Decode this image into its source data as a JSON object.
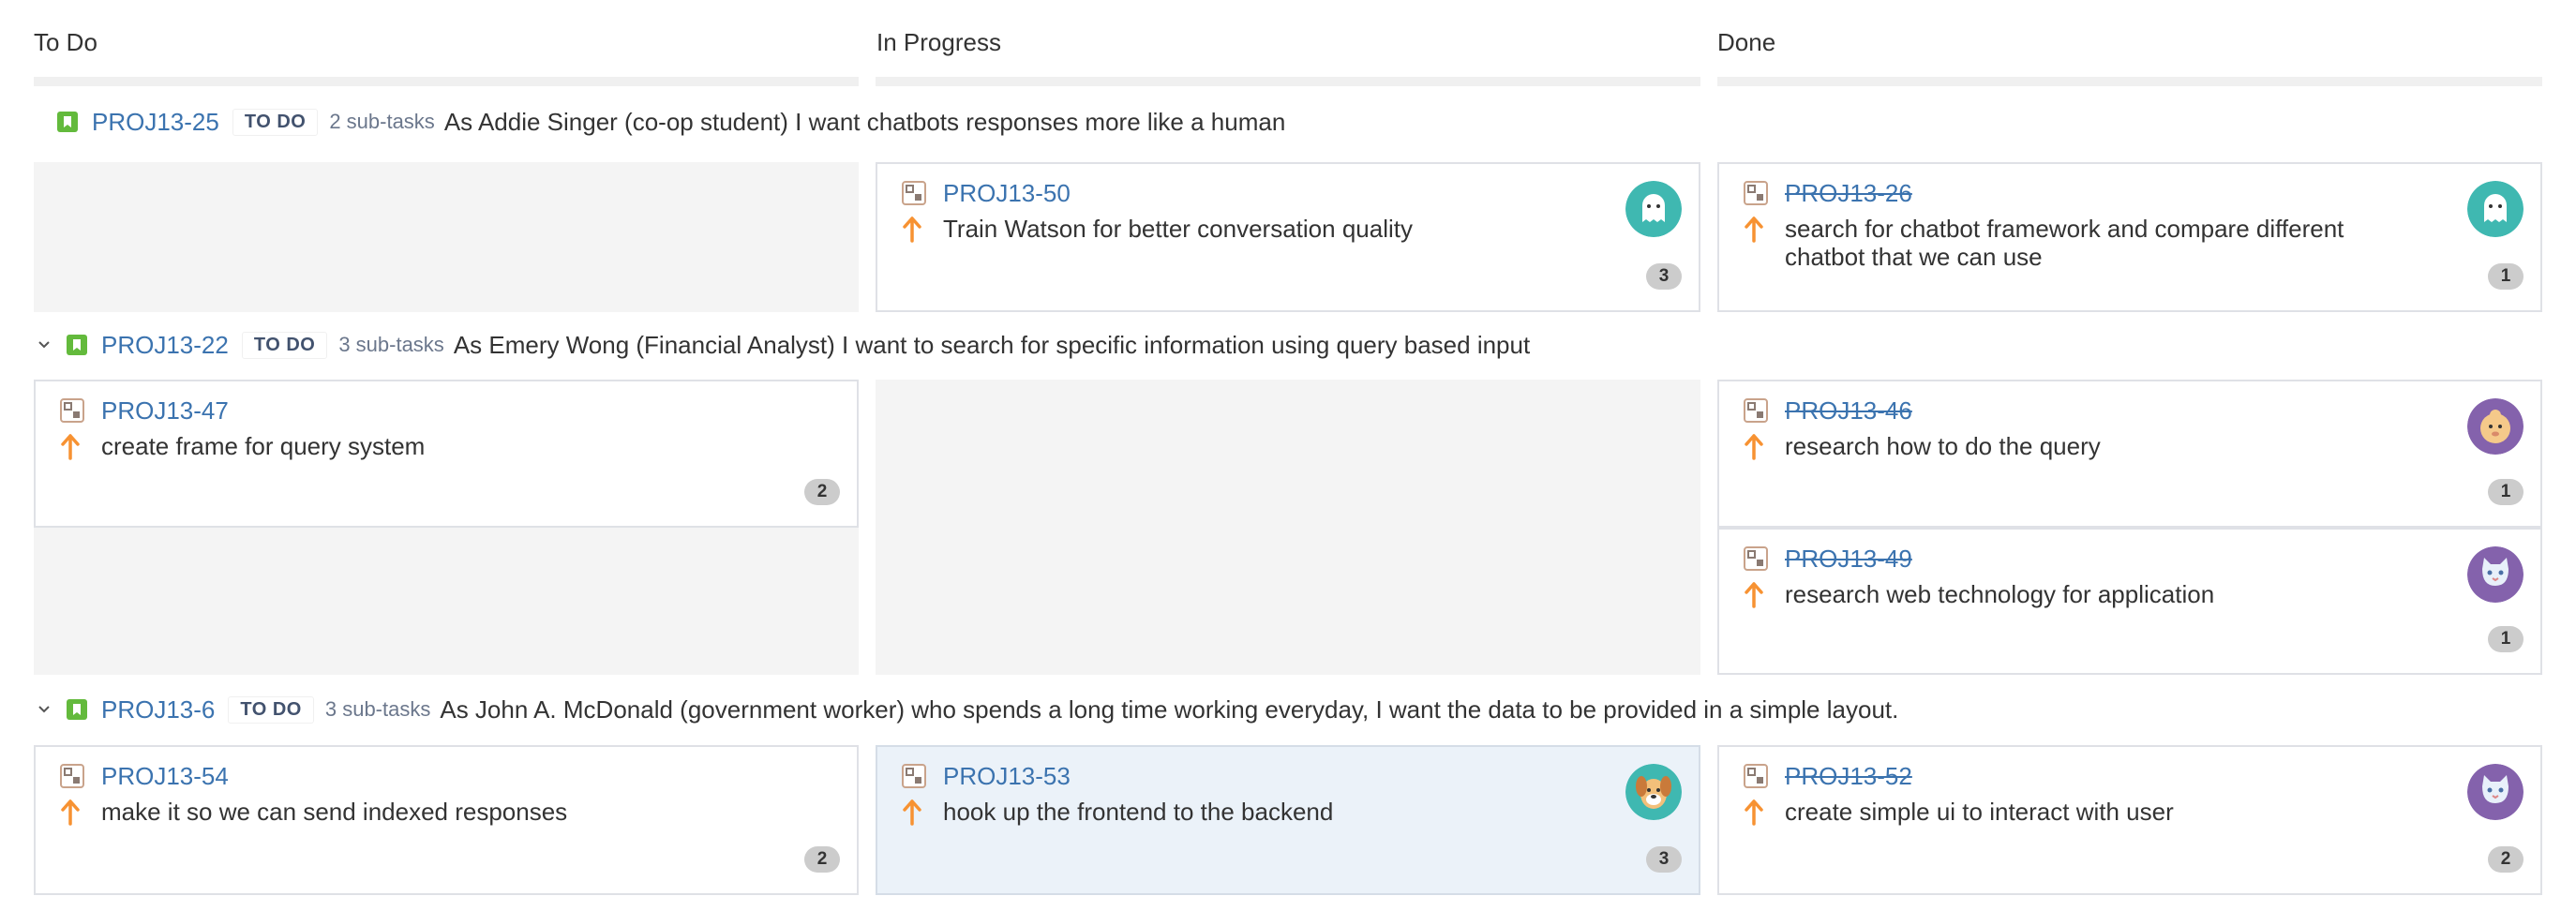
{
  "columns": [
    "To Do",
    "In Progress",
    "Done"
  ],
  "swimlanes": [
    {
      "key": "PROJ13-25",
      "status": "TO DO",
      "subtasks": "2 sub-tasks",
      "summary": "As Addie Singer (co-op student) I want chatbots responses more like a human",
      "collapsible": false
    },
    {
      "key": "PROJ13-22",
      "status": "TO DO",
      "subtasks": "3 sub-tasks",
      "summary": "As Emery Wong (Financial Analyst) I want to search for specific information using query based input",
      "collapsible": true
    },
    {
      "key": "PROJ13-6",
      "status": "TO DO",
      "subtasks": "3 sub-tasks",
      "summary": "As John A. McDonald (government worker) who spends a long time working everyday, I want the data to be provided in a simple layout.",
      "collapsible": true
    }
  ],
  "cards": {
    "c50": {
      "key": "PROJ13-50",
      "title": "Train Watson for better conversation quality",
      "count": "3",
      "avatar": "teal-ghost-avatar"
    },
    "c26": {
      "key": "PROJ13-26",
      "title": "search for chatbot framework and compare different chatbot that we can use",
      "count": "1",
      "avatar": "teal-ghost-avatar"
    },
    "c47": {
      "key": "PROJ13-47",
      "title": "create frame for query system",
      "count": "2"
    },
    "c46": {
      "key": "PROJ13-46",
      "title": "research how to do the query",
      "count": "1",
      "avatar": "purple-baby-avatar"
    },
    "c49": {
      "key": "PROJ13-49",
      "title": "research web technology for application",
      "count": "1",
      "avatar": "purple-cat-avatar"
    },
    "c54": {
      "key": "PROJ13-54",
      "title": "make it so we can send indexed responses",
      "count": "2"
    },
    "c53": {
      "key": "PROJ13-53",
      "title": "hook up the frontend to the backend",
      "count": "3",
      "avatar": "teal-dog-avatar"
    },
    "c52": {
      "key": "PROJ13-52",
      "title": "create simple ui to interact with user",
      "count": "2",
      "avatar": "purple-cat-avatar"
    }
  },
  "colors": {
    "link": "#3b73af",
    "priority": "#f79232",
    "story": "#63ba3c",
    "avatar_teal": "#3fb8b1",
    "avatar_purple": "#8462ac",
    "selected_bg": "#ebf2f9"
  }
}
